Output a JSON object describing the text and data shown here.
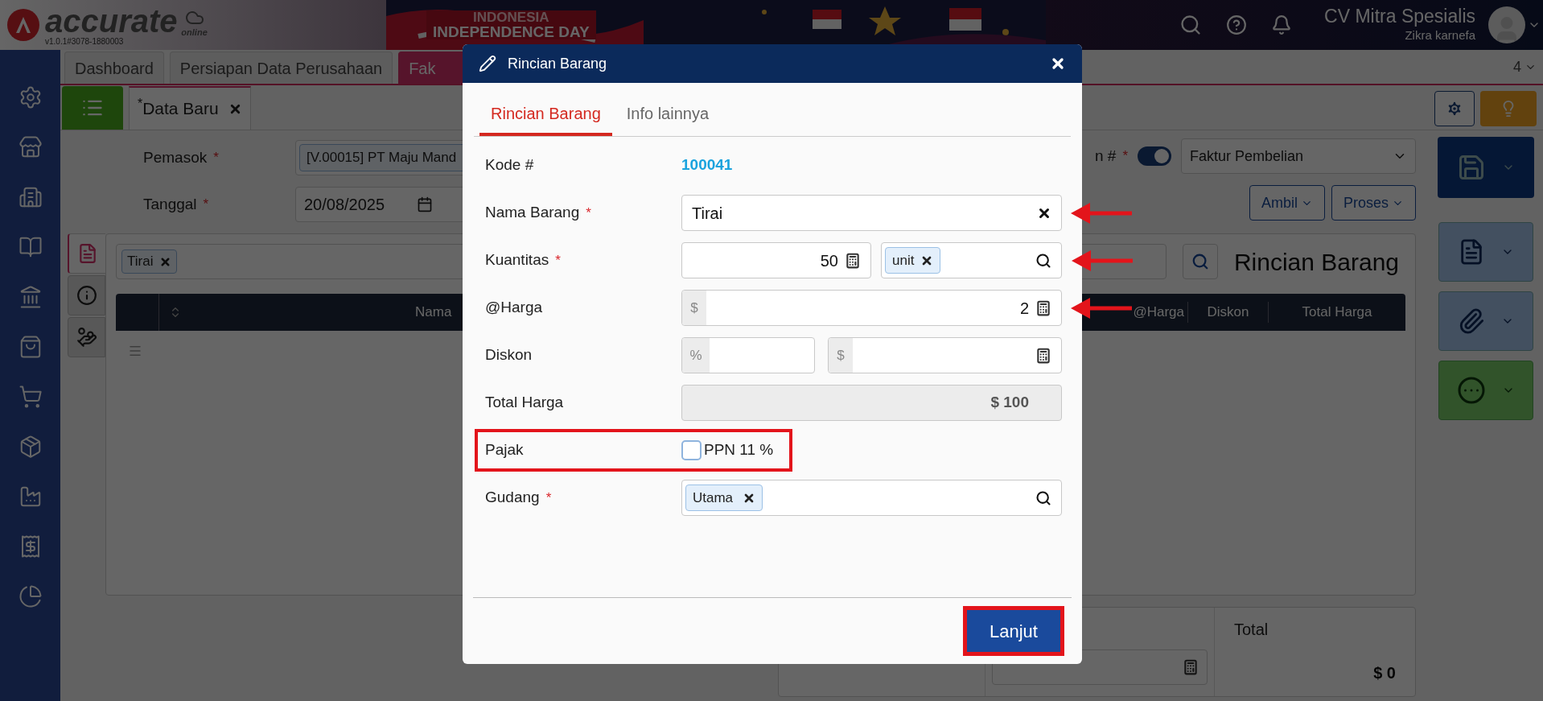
{
  "header": {
    "logo_text": "accurate",
    "logo_sub": "online",
    "version": "v1.0.1#3078-1880003",
    "banner_line1": "INDONESIA",
    "banner_line2": "INDEPENDENCE DAY",
    "company": "CV Mitra Spesialis",
    "user": "Zikra karnefa"
  },
  "tabs": [
    {
      "label": "Dashboard",
      "selected": false
    },
    {
      "label": "Persiapan Data Perusahaan",
      "selected": false
    },
    {
      "label": "Fak",
      "selected": true
    }
  ],
  "tab_count": "4",
  "doc_tab": {
    "modified_mark": "*",
    "label": "Data Baru"
  },
  "form": {
    "supplier_label": "Pemasok",
    "supplier_required": "*",
    "supplier_value": "[V.00015] PT Maju Mand",
    "date_label": "Tanggal",
    "date_required": "*",
    "date_value": "20/08/2025",
    "number_label": "n #",
    "number_required": "*",
    "auto_number": true,
    "type_value": "Faktur Pembelian"
  },
  "actions": [
    "Ambil",
    "Proses"
  ],
  "side_tabs": [
    {
      "kind": "document",
      "selected": true
    },
    {
      "kind": "info",
      "selected": false
    },
    {
      "kind": "money",
      "selected": false
    }
  ],
  "items_panel": {
    "filter_tag": "Tirai",
    "title": "Rincian Barang",
    "columns": [
      "Nama",
      "@Harga",
      "Diskon",
      "Total Harga"
    ]
  },
  "summary": {
    "total_label": "Total",
    "total_value": "$ 0"
  },
  "dialog": {
    "title": "Rincian Barang",
    "tabs": [
      {
        "label": "Rincian Barang",
        "selected": true
      },
      {
        "label": "Info lainnya",
        "selected": false
      }
    ],
    "fields": [
      {
        "kind": "link",
        "label": "Kode #",
        "value": "100041",
        "arrow": false
      },
      {
        "kind": "text",
        "label": "Nama Barang",
        "required": "*",
        "value": "Tirai",
        "arrow": true
      },
      {
        "kind": "quantity",
        "label": "Kuantitas",
        "required": "*",
        "value": "50",
        "unit": "unit",
        "arrow": true
      },
      {
        "kind": "money",
        "label": "@Harga",
        "prefix": "$",
        "value": "2",
        "arrow": true
      },
      {
        "kind": "discount",
        "label": "Diskon",
        "percent_prefix": "%",
        "amount_prefix": "$",
        "arrow": false
      },
      {
        "kind": "readonly",
        "label": "Total Harga",
        "value": "$ 100",
        "arrow": false
      },
      {
        "kind": "checkbox",
        "label": "Pajak",
        "option": "PPN 11 %",
        "checked": false,
        "highlighted": true,
        "arrow": false
      },
      {
        "kind": "tag",
        "label": "Gudang",
        "required": "*",
        "tag": "Utama",
        "arrow": false
      }
    ],
    "submit": {
      "label": "Lanjut",
      "highlighted": true
    }
  }
}
